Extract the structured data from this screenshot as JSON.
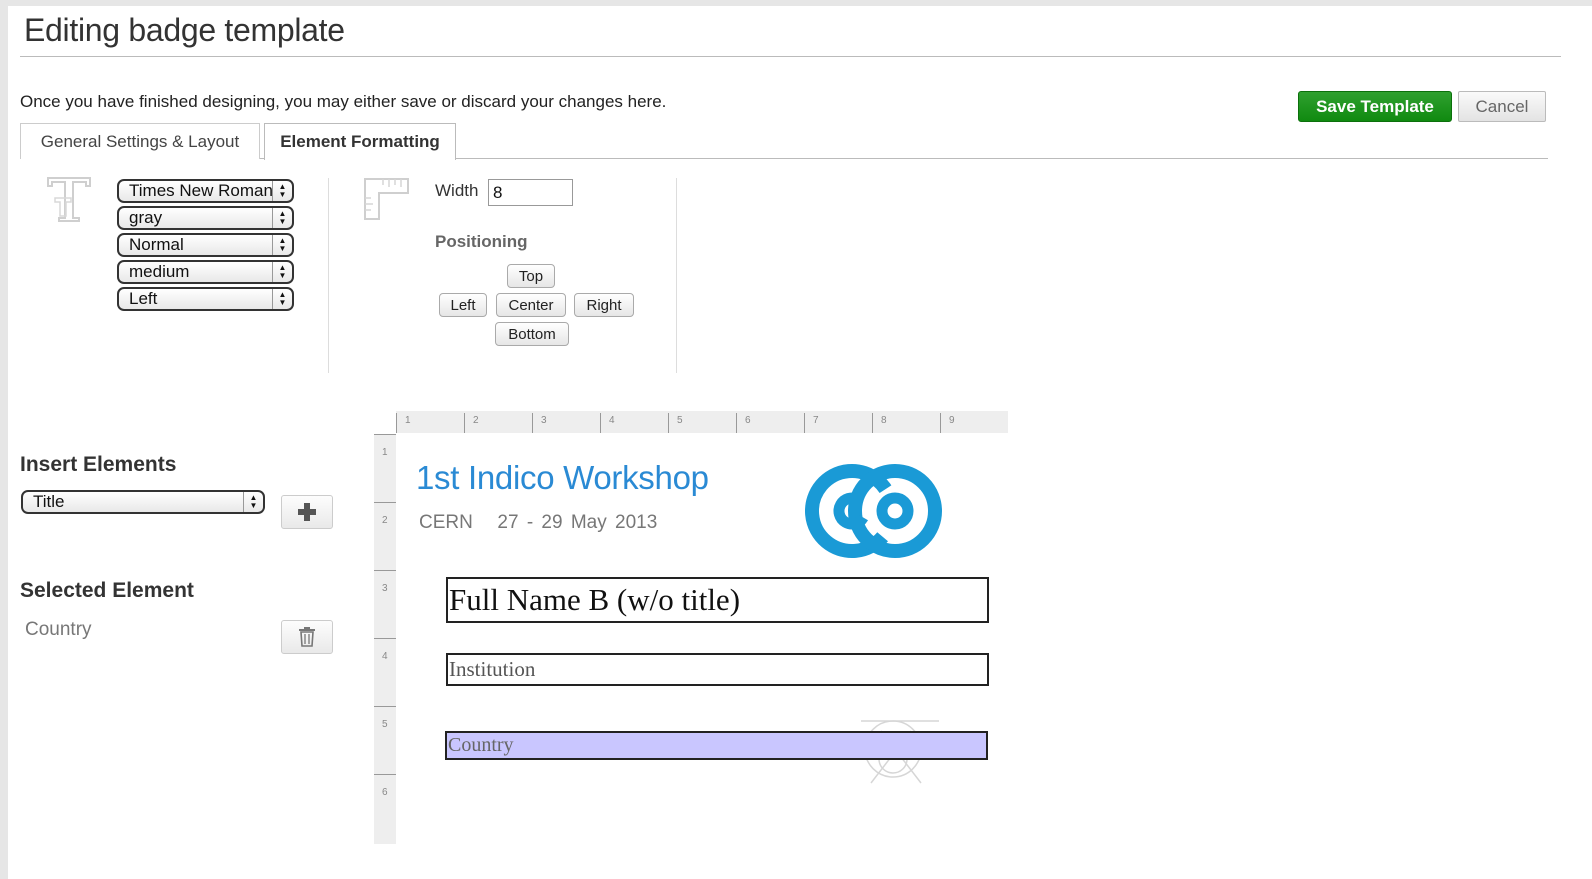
{
  "page": {
    "title": "Editing badge template",
    "intro": "Once you have finished designing, you may either save or discard your changes here."
  },
  "actions": {
    "save_label": "Save Template",
    "cancel_label": "Cancel"
  },
  "tabs": [
    {
      "label": "General Settings & Layout",
      "active": false
    },
    {
      "label": "Element Formatting",
      "active": true
    }
  ],
  "formatting": {
    "font_family": "Times New Roman",
    "color": "gray",
    "style": "Normal",
    "size": "medium",
    "alignment": "Left",
    "width_label": "Width",
    "width_value": "8",
    "positioning_label": "Positioning",
    "positions": {
      "top": "Top",
      "left": "Left",
      "center": "Center",
      "right": "Right",
      "bottom": "Bottom"
    }
  },
  "insert": {
    "heading": "Insert Elements",
    "selected_option": "Title"
  },
  "selected": {
    "heading": "Selected Element",
    "name": "Country"
  },
  "ruler": {
    "top": [
      "1",
      "2",
      "3",
      "4",
      "5",
      "6",
      "7",
      "8",
      "9"
    ],
    "left": [
      "1",
      "2",
      "3",
      "4",
      "5",
      "6"
    ]
  },
  "badge": {
    "event_title": "1st Indico Workshop",
    "event_location": "CERN",
    "event_dates": "27 - 29 May 2013",
    "fields": [
      {
        "label": "Full Name B (w/o title)",
        "selected": false
      },
      {
        "label": "Institution",
        "selected": false
      },
      {
        "label": "Country",
        "selected": true
      }
    ]
  },
  "colors": {
    "accent_green": "#119011",
    "logo_blue": "#1a9ad6",
    "selected_fill": "#c9c6ff",
    "title_blue": "#2a8ad4"
  },
  "icons": [
    "text-format-icon",
    "ruler-icon",
    "plus-icon",
    "trash-icon",
    "indico-logo",
    "cern-watermark"
  ]
}
